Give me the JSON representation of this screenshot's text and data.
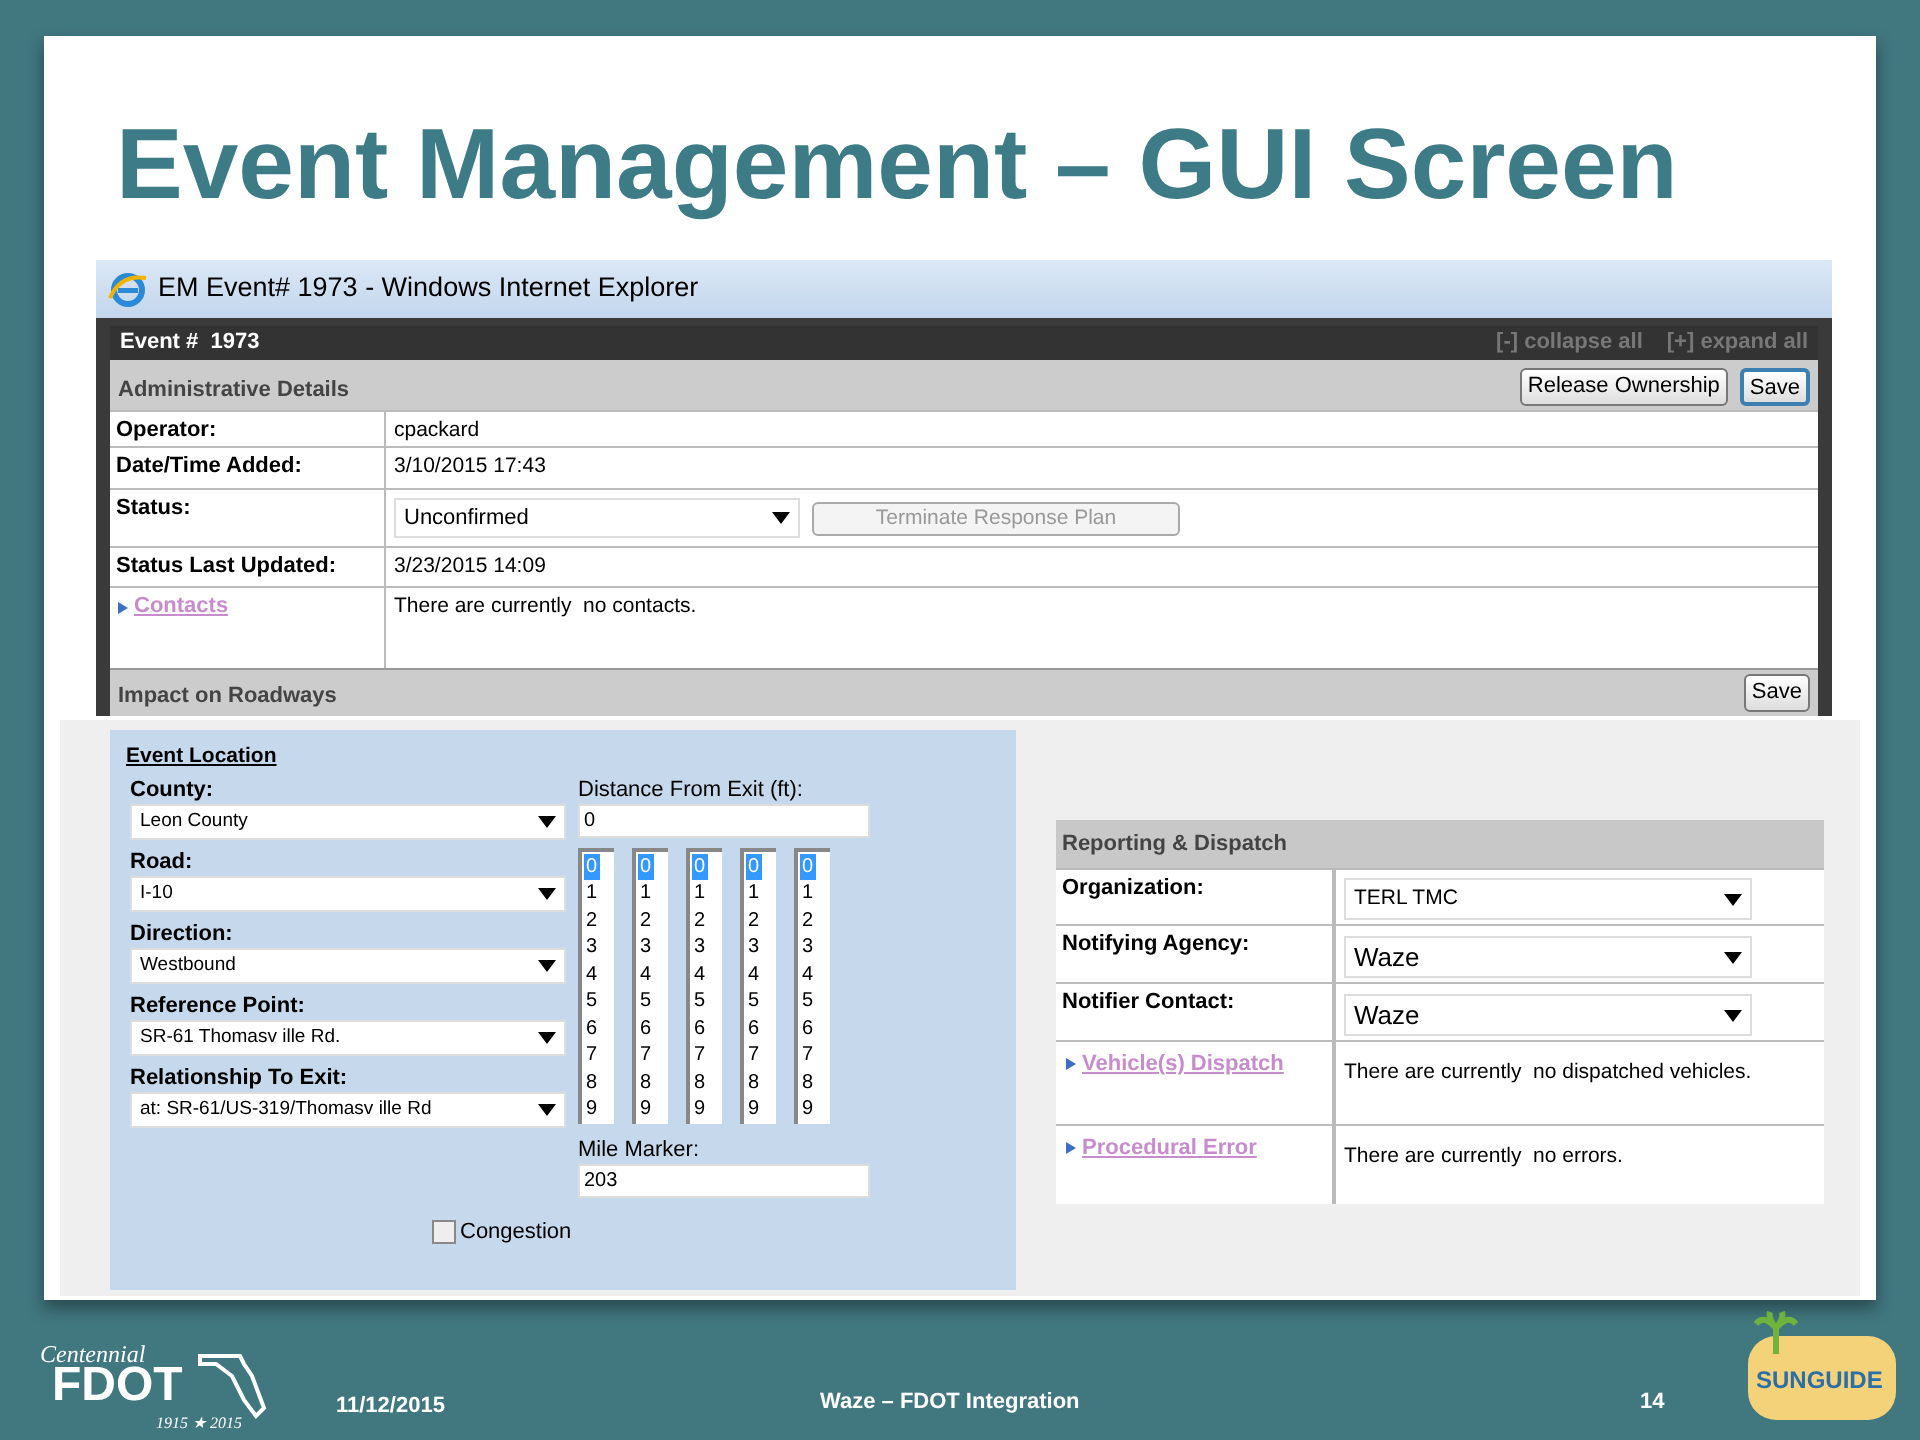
{
  "slide": {
    "title": "Event Management – GUI Screen"
  },
  "browser": {
    "title": "EM Event# 1973 - Windows Internet Explorer"
  },
  "event_header": {
    "title": "Event #  1973",
    "links": [
      "[-] collapse all",
      "[+] expand all"
    ]
  },
  "admin": {
    "title": "Administrative Details",
    "buttons": [
      "Release Ownership",
      "Save"
    ],
    "rows": [
      {
        "kind": "text",
        "label": "Operator:",
        "value": "cpackard"
      },
      {
        "kind": "text",
        "label": "Date/Time Added:",
        "value": "3/10/2015 17:43"
      },
      {
        "kind": "select",
        "label": "Status:",
        "value": "Unconfirmed",
        "button": {
          "label": "Terminate Response Plan",
          "disabled": true
        }
      },
      {
        "kind": "text",
        "label": "Status Last Updated:",
        "value": "3/23/2015 14:09"
      },
      {
        "kind": "link",
        "label": "Contacts",
        "value": "There are currently  no contacts."
      }
    ]
  },
  "impact": {
    "title": "Impact on Roadways",
    "button": "Save"
  },
  "location": {
    "title": "Event Location",
    "selects": [
      {
        "label": "County:",
        "value": "Leon County"
      },
      {
        "label": "Road:",
        "value": "I-10"
      },
      {
        "label": "Direction:",
        "value": "Westbound"
      },
      {
        "label": "Reference Point:",
        "value": "SR-61 Thomasv ille Rd."
      },
      {
        "label": "Relationship To Exit:",
        "value": "at: SR-61/US-319/Thomasv ille Rd"
      }
    ],
    "distance": {
      "label": "Distance From Exit (ft):",
      "value": "0"
    },
    "digit_lists": [
      {
        "options": [
          {
            "label": "0",
            "selected": true
          },
          {
            "label": "1",
            "selected": false
          },
          {
            "label": "2",
            "selected": false
          },
          {
            "label": "3",
            "selected": false
          },
          {
            "label": "4",
            "selected": false
          },
          {
            "label": "5",
            "selected": false
          },
          {
            "label": "6",
            "selected": false
          },
          {
            "label": "7",
            "selected": false
          },
          {
            "label": "8",
            "selected": false
          },
          {
            "label": "9",
            "selected": false
          }
        ]
      },
      {
        "options": [
          {
            "label": "0",
            "selected": true
          },
          {
            "label": "1",
            "selected": false
          },
          {
            "label": "2",
            "selected": false
          },
          {
            "label": "3",
            "selected": false
          },
          {
            "label": "4",
            "selected": false
          },
          {
            "label": "5",
            "selected": false
          },
          {
            "label": "6",
            "selected": false
          },
          {
            "label": "7",
            "selected": false
          },
          {
            "label": "8",
            "selected": false
          },
          {
            "label": "9",
            "selected": false
          }
        ]
      },
      {
        "options": [
          {
            "label": "0",
            "selected": true
          },
          {
            "label": "1",
            "selected": false
          },
          {
            "label": "2",
            "selected": false
          },
          {
            "label": "3",
            "selected": false
          },
          {
            "label": "4",
            "selected": false
          },
          {
            "label": "5",
            "selected": false
          },
          {
            "label": "6",
            "selected": false
          },
          {
            "label": "7",
            "selected": false
          },
          {
            "label": "8",
            "selected": false
          },
          {
            "label": "9",
            "selected": false
          }
        ]
      },
      {
        "options": [
          {
            "label": "0",
            "selected": true
          },
          {
            "label": "1",
            "selected": false
          },
          {
            "label": "2",
            "selected": false
          },
          {
            "label": "3",
            "selected": false
          },
          {
            "label": "4",
            "selected": false
          },
          {
            "label": "5",
            "selected": false
          },
          {
            "label": "6",
            "selected": false
          },
          {
            "label": "7",
            "selected": false
          },
          {
            "label": "8",
            "selected": false
          },
          {
            "label": "9",
            "selected": false
          }
        ]
      },
      {
        "options": [
          {
            "label": "0",
            "selected": true
          },
          {
            "label": "1",
            "selected": false
          },
          {
            "label": "2",
            "selected": false
          },
          {
            "label": "3",
            "selected": false
          },
          {
            "label": "4",
            "selected": false
          },
          {
            "label": "5",
            "selected": false
          },
          {
            "label": "6",
            "selected": false
          },
          {
            "label": "7",
            "selected": false
          },
          {
            "label": "8",
            "selected": false
          },
          {
            "label": "9",
            "selected": false
          }
        ]
      }
    ],
    "mile_marker": {
      "label": "Mile Marker:",
      "value": "203"
    },
    "congestion": {
      "label": "Congestion",
      "checked": false
    }
  },
  "reporting": {
    "title": "Reporting & Dispatch",
    "rows": [
      {
        "kind": "select",
        "label": "Organization:",
        "value": "TERL TMC"
      },
      {
        "kind": "select",
        "label": "Notifying Agency:",
        "value": "Waze"
      },
      {
        "kind": "select",
        "label": "Notifier Contact:",
        "value": "Waze"
      },
      {
        "kind": "link",
        "label": "Vehicle(s) Dispatch",
        "value": "There are currently  no dispatched vehicles."
      },
      {
        "kind": "link",
        "label": "Procedural Error",
        "value": "There are currently  no errors."
      }
    ]
  },
  "footer": {
    "date": "11/12/2015",
    "title": "Waze – FDOT Integration",
    "page": "14",
    "left_logo": {
      "top": "Centennial",
      "main": "FDOT",
      "years": "1915 ★ 2015"
    },
    "right_logo": "SUNGUIDE"
  }
}
